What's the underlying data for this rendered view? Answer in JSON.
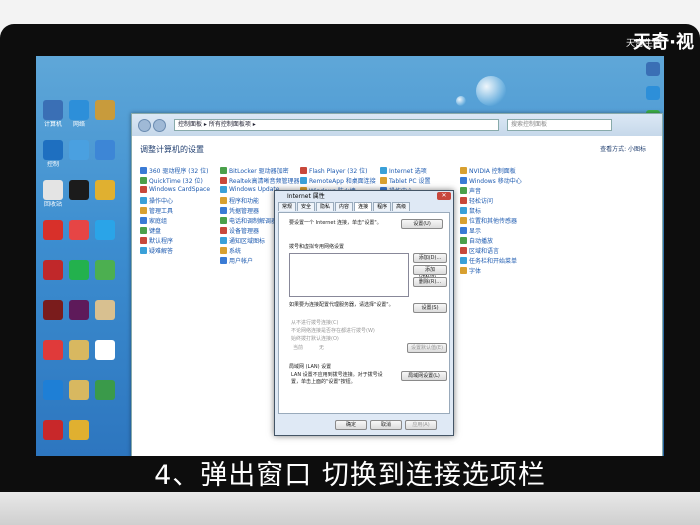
{
  "watermark": {
    "text": "天奇·视",
    "sub": "天奇生活"
  },
  "caption": "4、弹出窗口 切换到连接选项栏",
  "desktop_icons": [
    {
      "label": "计算机",
      "color": "#3a6fb5"
    },
    {
      "label": "网络",
      "color": "#2d8fd9"
    },
    {
      "label": "",
      "color": "#c89b3c"
    },
    {
      "label": "控制",
      "color": "#1e6fc0"
    },
    {
      "label": "",
      "color": "#4aa0e0"
    },
    {
      "label": "",
      "color": "#3d86d6"
    },
    {
      "label": "回收站",
      "color": "#e4e4e4"
    },
    {
      "label": "",
      "color": "#1b1b1b"
    },
    {
      "label": "",
      "color": "#e0b030"
    },
    {
      "label": "",
      "color": "#d8302a"
    },
    {
      "label": "",
      "color": "#e64545"
    },
    {
      "label": "",
      "color": "#2aa4e8"
    },
    {
      "label": "",
      "color": "#c0282a"
    },
    {
      "label": "",
      "color": "#23b14d"
    },
    {
      "label": "",
      "color": "#4caf50"
    },
    {
      "label": "",
      "color": "#7a1c1c"
    },
    {
      "label": "",
      "color": "#5e1a5a"
    },
    {
      "label": "",
      "color": "#d8c090"
    },
    {
      "label": "",
      "color": "#e03a3a"
    },
    {
      "label": "",
      "color": "#d8b860"
    },
    {
      "label": "",
      "color": "#ffffff"
    },
    {
      "label": "",
      "color": "#1e7fd6"
    },
    {
      "label": "",
      "color": "#d8b860"
    },
    {
      "label": "",
      "color": "#3a9a4a"
    },
    {
      "label": "",
      "color": "#c8282a"
    },
    {
      "label": "",
      "color": "#e0b030"
    }
  ],
  "control_panel": {
    "title": "调整计算机的设置",
    "view_label": "查看方式: 小图标",
    "address": "控制面板 ▸ 所有控制面板项 ▸",
    "search_placeholder": "搜索控制面板",
    "columns": [
      [
        "360 驱动程序 (32 位)",
        "QuickTime (32 位)",
        "Windows CardSpace",
        "操作中心",
        "管理工具",
        "家庭组",
        "键盘",
        "默认程序",
        "疑难解答"
      ],
      [
        "BitLocker 驱动器加密",
        "Realtek高清晰音频管理器",
        "Windows Update",
        "程序和功能",
        "凭据管理器",
        "电话和调制解调器",
        "设备管理器",
        "通知区域图标",
        "系统",
        "用户帐户"
      ],
      [
        "Flash Player (32 位)",
        "RemoteApp 和桌面连接",
        "Windows 防火墙"
      ],
      [
        "Internet 选项",
        "Tablet PC 设置",
        "操作中心"
      ],
      [
        "NVIDIA 控制面板",
        "Windows 移动中心",
        "声音",
        "轻松访问",
        "鼠标",
        "位置和其他传感器",
        "显示",
        "自动播放",
        "区域和语言",
        "任务栏和开始菜单",
        "字体"
      ]
    ]
  },
  "dialog": {
    "title": "Internet 属性",
    "tabs": [
      "常规",
      "安全",
      "隐私",
      "内容",
      "连接",
      "程序",
      "高级"
    ],
    "active_tab": "连接",
    "setup_text": "要设置一个 Internet 连接，单击\"设置\"。",
    "setup_button": "设置(U)",
    "dialup_header": "拨号和虚拟专用网络设置",
    "add_button": "添加(D)...",
    "add_vpn_button": "添加 VPN(P)...",
    "remove_button": "删除(R)...",
    "settings_button": "设置(S)",
    "hint_text": "如果要为连接配置代理服务器，请选择\"设置\"。",
    "radio_never": "从不进行拨号连接(C)",
    "radio_no_net": "不论网络连接是否存在都进行拨号(W)",
    "radio_always": "始终拨打默认连接(O)",
    "current_label": "当前",
    "current_value": "无",
    "default_button": "设置默认值(E)",
    "lan_header": "局域网 (LAN) 设置",
    "lan_text": "LAN 设置不应用到拨号连接。对于拨号设置，单击上面的\"设置\"按钮。",
    "lan_button": "局域网设置(L)",
    "ok_button": "确定",
    "cancel_button": "取消",
    "apply_button": "应用(A)"
  }
}
